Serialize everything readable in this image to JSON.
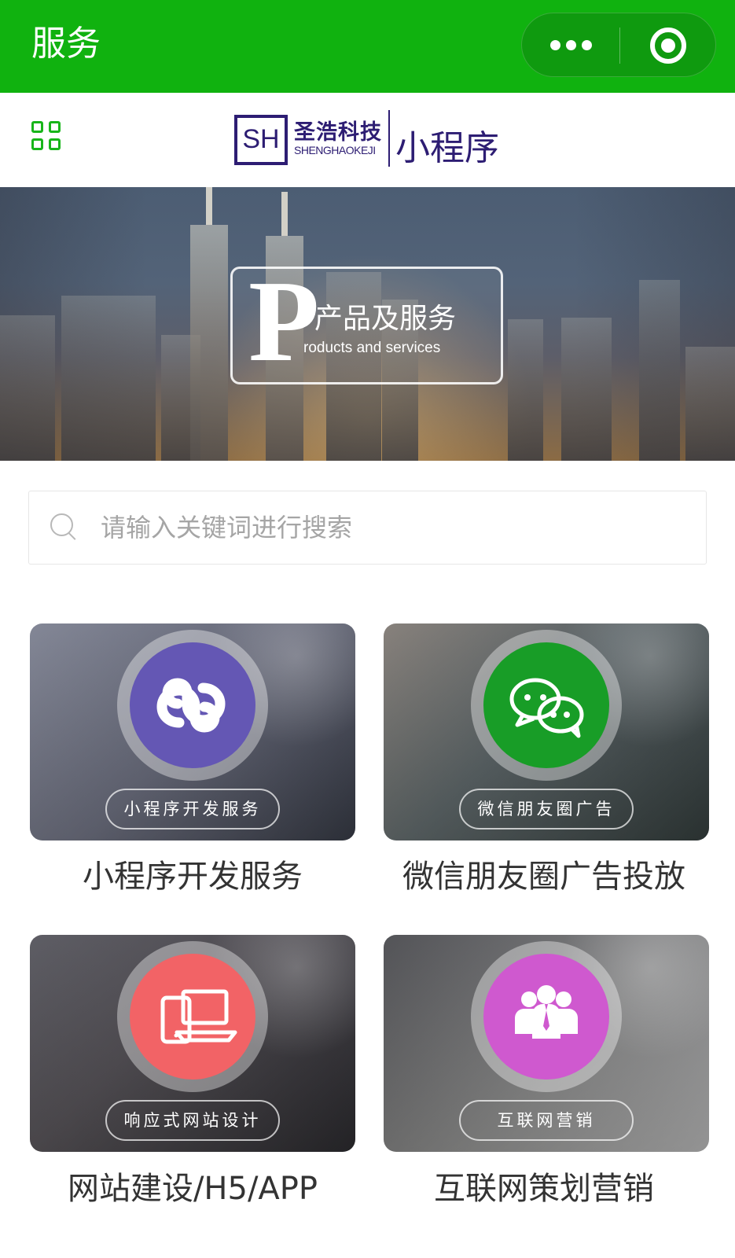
{
  "topbar": {
    "title": "服务",
    "more_icon": "more-dots-icon",
    "close_icon": "target-icon",
    "background": "#10b20f"
  },
  "header": {
    "menu_icon": "grid-icon",
    "logo_mark": "SH",
    "logo_cn": "圣浩科技",
    "logo_en": "SHENGHAOKEJI",
    "logo_suffix": "小程序"
  },
  "hero": {
    "letter": "P",
    "title_cn": "产品及服务",
    "title_en": "roducts and services"
  },
  "search": {
    "placeholder": "请输入关键词进行搜索",
    "icon": "search-icon"
  },
  "services": [
    {
      "label": "小程序开发服务",
      "caption": "小程序开发服务",
      "icon": "miniprogram-icon",
      "color": "#6457b4"
    },
    {
      "label": "微信朋友圈广告",
      "caption": "微信朋友圈广告投放",
      "icon": "chat-icon",
      "color": "#189d27"
    },
    {
      "label": "响应式网站设计",
      "caption": "网站建设/H5/APP",
      "icon": "devices-icon",
      "color": "#f26366"
    },
    {
      "label": "互联网营销",
      "caption": "互联网策划营销",
      "icon": "team-icon",
      "color": "#cf59cf"
    }
  ]
}
